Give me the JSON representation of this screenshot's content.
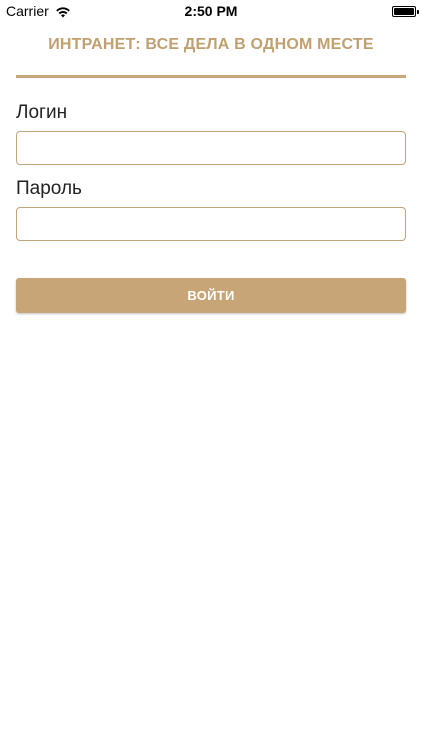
{
  "status_bar": {
    "carrier": "Carrier",
    "time": "2:50 PM",
    "wifi_icon": "wifi-icon",
    "battery_icon": "battery-icon"
  },
  "header": {
    "title": "ИНТРАНЕТ: ВСЕ ДЕЛА В ОДНОМ МЕСТЕ"
  },
  "form": {
    "login_label": "Логин",
    "login_value": "",
    "password_label": "Пароль",
    "password_value": "",
    "submit_label": "ВОЙТИ"
  },
  "colors": {
    "accent": "#c7a576",
    "title": "#c0a071",
    "input_border": "#bfa679"
  }
}
